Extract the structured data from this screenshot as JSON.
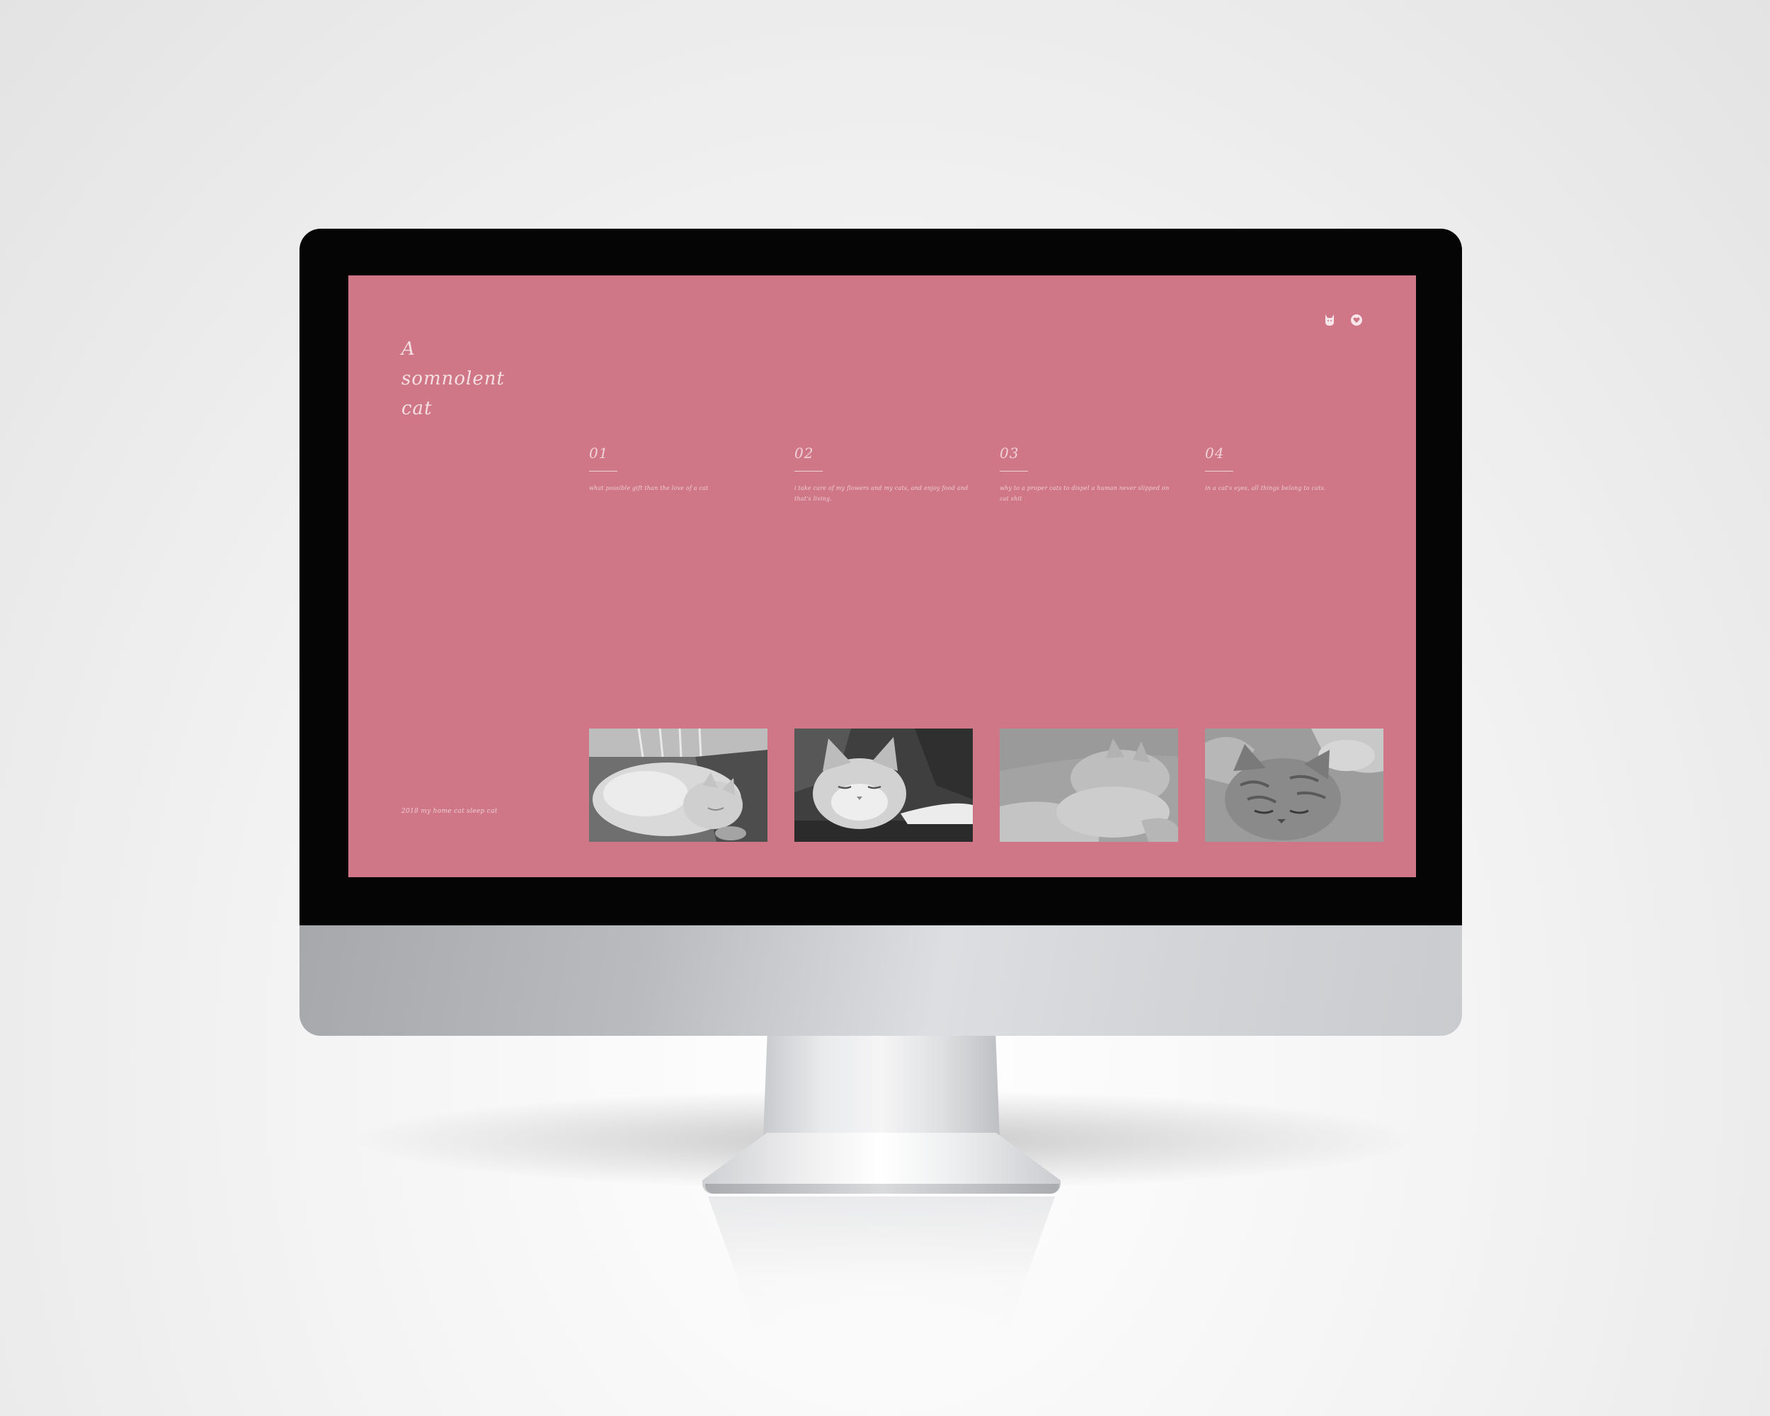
{
  "site": {
    "title": "A somnolent cat",
    "footer": "2018 my home cat sleep cat"
  },
  "header": {
    "icons": [
      "cat-icon",
      "heart-icon"
    ]
  },
  "features": [
    {
      "number": "01",
      "text": "what possible gift than the love of a cat"
    },
    {
      "number": "02",
      "text": "i take care of my flowers and my cats, and enjoy food and that's living."
    },
    {
      "number": "03",
      "text": "why to a proper cats to dispel a human never slipped on cat shit"
    },
    {
      "number": "04",
      "text": "in a cat's eyes, all things belong to cats."
    }
  ],
  "photos": [
    {
      "subject": "white cat curled up asleep"
    },
    {
      "subject": "fluffy cat sleeping face-forward"
    },
    {
      "subject": "grey cat napping on blanket"
    },
    {
      "subject": "tabby kitten sleeping in hand"
    }
  ],
  "colors": {
    "screen_background": "#cf7787",
    "text": "#f2d2d8",
    "bezel": "#050505"
  }
}
